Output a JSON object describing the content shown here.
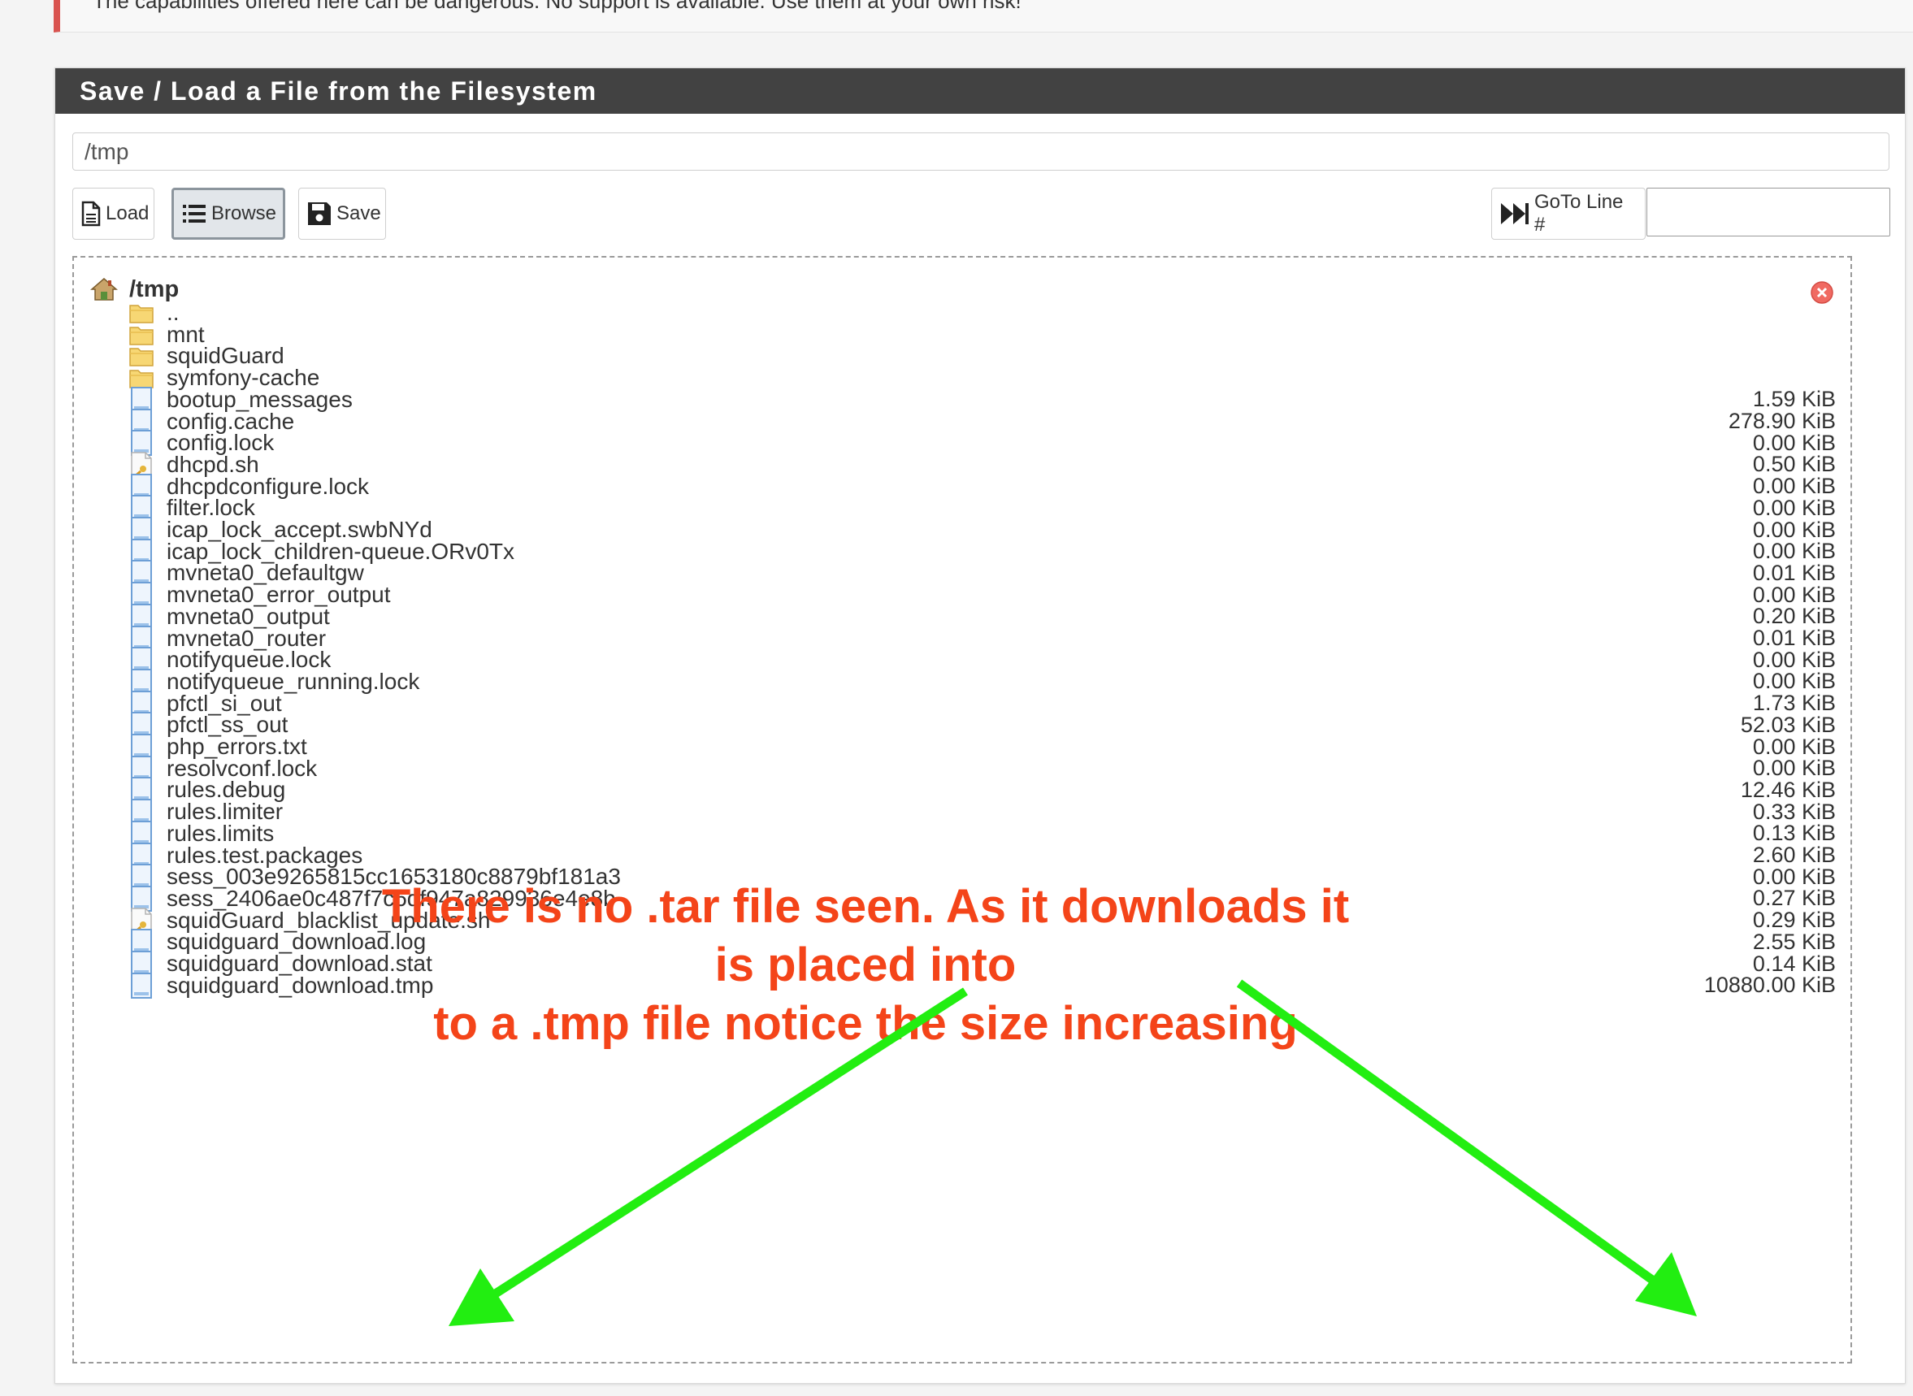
{
  "warning": {
    "text": "The capabilities offered here can be dangerous. No support is available. Use them at your own risk!"
  },
  "panel": {
    "title": "Save / Load a File from the Filesystem"
  },
  "path_input": {
    "value": "/tmp"
  },
  "toolbar": {
    "load_label": "Load",
    "browse_label": "Browse",
    "save_label": "Save",
    "goto_label": "GoTo Line #",
    "goto_value": ""
  },
  "browser": {
    "current_dir": "/tmp",
    "entries": [
      {
        "name": "..",
        "type": "folder",
        "size": ""
      },
      {
        "name": "mnt",
        "type": "folder",
        "size": ""
      },
      {
        "name": "squidGuard",
        "type": "folder",
        "size": ""
      },
      {
        "name": "symfony-cache",
        "type": "folder",
        "size": ""
      },
      {
        "name": "bootup_messages",
        "type": "file",
        "size": "1.59 KiB"
      },
      {
        "name": "config.cache",
        "type": "file",
        "size": "278.90 KiB"
      },
      {
        "name": "config.lock",
        "type": "file",
        "size": "0.00 KiB"
      },
      {
        "name": "dhcpd.sh",
        "type": "script",
        "size": "0.50 KiB"
      },
      {
        "name": "dhcpdconfigure.lock",
        "type": "file",
        "size": "0.00 KiB"
      },
      {
        "name": "filter.lock",
        "type": "file",
        "size": "0.00 KiB"
      },
      {
        "name": "icap_lock_accept.swbNYd",
        "type": "file",
        "size": "0.00 KiB"
      },
      {
        "name": "icap_lock_children-queue.ORv0Tx",
        "type": "file",
        "size": "0.00 KiB"
      },
      {
        "name": "mvneta0_defaultgw",
        "type": "file",
        "size": "0.01 KiB"
      },
      {
        "name": "mvneta0_error_output",
        "type": "file",
        "size": "0.00 KiB"
      },
      {
        "name": "mvneta0_output",
        "type": "file",
        "size": "0.20 KiB"
      },
      {
        "name": "mvneta0_router",
        "type": "file",
        "size": "0.01 KiB"
      },
      {
        "name": "notifyqueue.lock",
        "type": "file",
        "size": "0.00 KiB"
      },
      {
        "name": "notifyqueue_running.lock",
        "type": "file",
        "size": "0.00 KiB"
      },
      {
        "name": "pfctl_si_out",
        "type": "file",
        "size": "1.73 KiB"
      },
      {
        "name": "pfctl_ss_out",
        "type": "file",
        "size": "52.03 KiB"
      },
      {
        "name": "php_errors.txt",
        "type": "file",
        "size": "0.00 KiB"
      },
      {
        "name": "resolvconf.lock",
        "type": "file",
        "size": "0.00 KiB"
      },
      {
        "name": "rules.debug",
        "type": "file",
        "size": "12.46 KiB"
      },
      {
        "name": "rules.limiter",
        "type": "file",
        "size": "0.33 KiB"
      },
      {
        "name": "rules.limits",
        "type": "file",
        "size": "0.13 KiB"
      },
      {
        "name": "rules.test.packages",
        "type": "file",
        "size": "2.60 KiB"
      },
      {
        "name": "sess_003e9265815cc1653180c8879bf181a3",
        "type": "file",
        "size": "0.00 KiB"
      },
      {
        "name": "sess_2406ae0c487f7c6df947a829936e4e8b",
        "type": "file",
        "size": "0.27 KiB"
      },
      {
        "name": "squidGuard_blacklist_update.sh",
        "type": "script",
        "size": "0.29 KiB"
      },
      {
        "name": "squidguard_download.log",
        "type": "file",
        "size": "2.55 KiB"
      },
      {
        "name": "squidguard_download.stat",
        "type": "file",
        "size": "0.14 KiB"
      },
      {
        "name": "squidguard_download.tmp",
        "type": "file",
        "size": "10880.00 KiB"
      }
    ]
  },
  "annotation": {
    "line1": "There is no .tar file seen. As it downloads it is placed into",
    "line2": "to  a .tmp file notice the size increasing",
    "text_color": "#f44419",
    "arrow_color": "#22ee11"
  }
}
